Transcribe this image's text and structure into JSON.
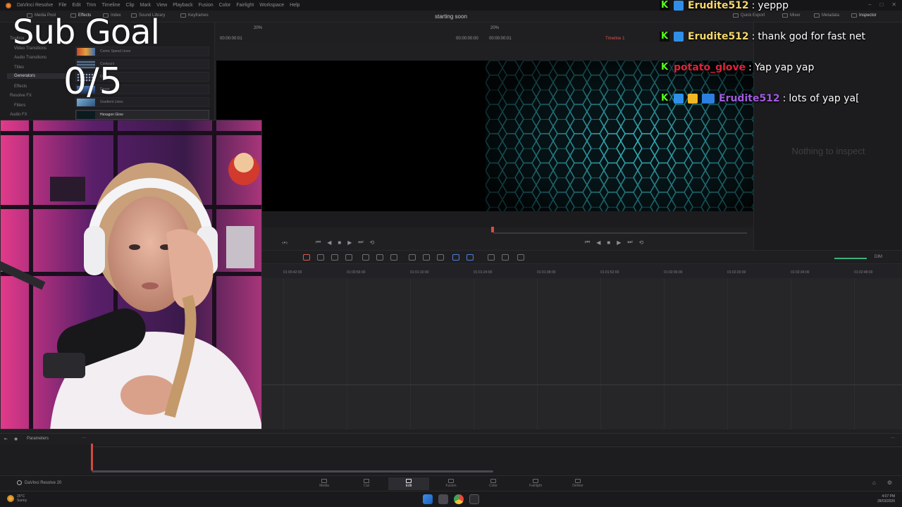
{
  "app": {
    "name": "DaVinci Resolve",
    "menu": [
      "File",
      "Edit",
      "Trim",
      "Timeline",
      "Clip",
      "Mark",
      "View",
      "Playback",
      "Fusion",
      "Color",
      "Fairlight",
      "Workspace",
      "Help"
    ],
    "project_title": "starting soon"
  },
  "toolbar": {
    "items": [
      "Media Pool",
      "Effects",
      "Index",
      "Sound Library",
      "Keyframes",
      "Quick Export",
      "Mixer",
      "Metadata",
      "Inspector"
    ]
  },
  "effects_panel": {
    "tree": [
      "Toolbox",
      "Video Transitions",
      "Audio Transitions",
      "Titles",
      "Generators",
      "Effects",
      "Resolve FX",
      "Filters",
      "Audio FX"
    ],
    "selected_tree": "Generators",
    "items": [
      "Comic Speed Lines",
      "Contours",
      "Dots",
      "Drops",
      "Gradient Lines",
      "Hexagon Glow"
    ],
    "selected_item": "Hexagon Glow"
  },
  "viewer": {
    "source_zoom": "20%",
    "timeline_zoom": "20%",
    "source_tc": "00:00:00:01",
    "source_tc_right": "00:00:00:00",
    "timeline_tc": "00:00:00:01",
    "timeline_name": "Timeline 1"
  },
  "inspector": {
    "empty_text": "Nothing to inspect"
  },
  "edit_toolbar": {
    "dim_label": "DIM"
  },
  "timeline": {
    "ruler": [
      "01:00:42:00",
      "01:00:56:00",
      "01:01:10:00",
      "01:01:24:00",
      "01:01:38:00",
      "01:01:52:00",
      "01:02:06:00",
      "01:02:20:00",
      "01:02:34:00",
      "01:02:48:00"
    ]
  },
  "params": {
    "label": "Parameters"
  },
  "page_nav": {
    "brand": "DaVinci Resolve 20",
    "tabs": [
      "Media",
      "Cut",
      "Edit",
      "Fusion",
      "Color",
      "Fairlight",
      "Deliver"
    ],
    "active_tab": "Edit"
  },
  "taskbar": {
    "weather_temp": "26°C",
    "weather_desc": "Sunny",
    "time": "4:07 PM",
    "date": "28/03/2026"
  },
  "overlay": {
    "sub_goal_label": "Sub Goal",
    "sub_goal_count": "0/5"
  },
  "chat": [
    {
      "user": "Erudite512",
      "user_color": "#f6d86c",
      "message": "yeppp",
      "badges": [
        "k",
        "mod"
      ]
    },
    {
      "user": "Erudite512",
      "user_color": "#f6d86c",
      "message": "thank god for fast net",
      "badges": [
        "k",
        "mod"
      ]
    },
    {
      "user": "potato_glove",
      "user_color": "#e0243a",
      "message": "Yap yap yap",
      "badges": [
        "k"
      ]
    },
    {
      "user": "Erudite512",
      "user_color": "#a35be0",
      "message": "lots of yap ya[",
      "badges": [
        "k",
        "mod",
        "crown",
        "og"
      ]
    }
  ],
  "colors": {
    "accent_red": "#e0493d",
    "kick_green": "#53fc18",
    "mod_blue": "#2f8fe8",
    "hex_glow": "#3fd6e0"
  }
}
